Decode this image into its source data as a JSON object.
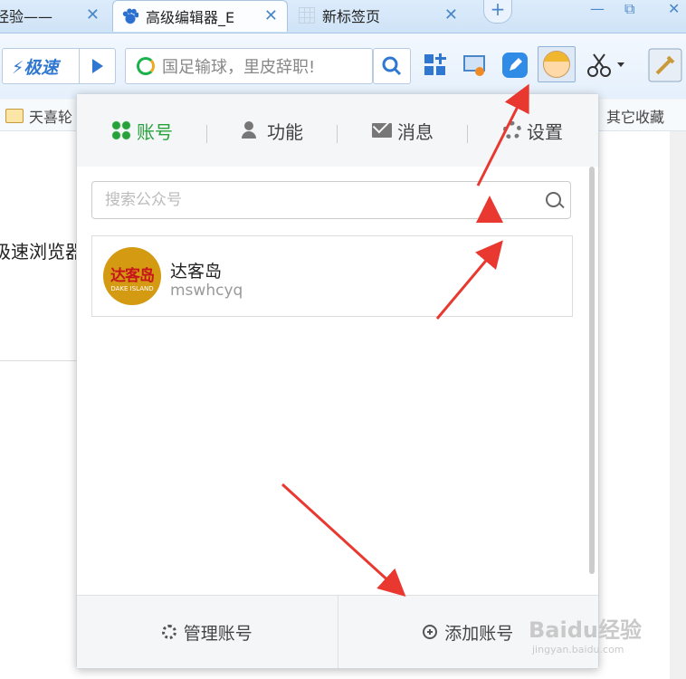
{
  "tabs": [
    {
      "label": "经验——",
      "active": false
    },
    {
      "label": "高级编辑器_E",
      "active": true,
      "icon": "baidu-paw-icon"
    },
    {
      "label": "新标签页",
      "active": false,
      "icon": "grid-icon"
    }
  ],
  "window_controls": {
    "minimize": "—",
    "restore": "⧉",
    "close": "✕"
  },
  "toolbar": {
    "speed_label": "⚡极速",
    "search_text": "国足输球，里皮辞职!",
    "icons": [
      "search-button-icon",
      "apps-plus-icon",
      "screenshot-icon",
      "edit-icon",
      "avatar-icon",
      "scissors-icon",
      "tools-icon"
    ]
  },
  "bookmarks": {
    "left_label": "天喜轮",
    "right_label": "其它收藏"
  },
  "page_behind": {
    "text": "极速浏览器"
  },
  "panel": {
    "tabs": [
      {
        "label": "账号",
        "active": true,
        "icon": "apps-icon"
      },
      {
        "label": "功能",
        "active": false,
        "icon": "user-gear-icon"
      },
      {
        "label": "消息",
        "active": false,
        "icon": "mail-icon"
      },
      {
        "label": "设置",
        "active": false,
        "icon": "gear-icon"
      }
    ],
    "search_placeholder": "搜索公众号",
    "account": {
      "name": "达客岛",
      "id": "mswhcyq",
      "logo_text": "达客岛",
      "logo_sub": "DAKE ISLAND"
    },
    "footer": {
      "manage_label": "管理账号",
      "add_label": "添加账号"
    }
  },
  "watermark": {
    "main": "Baidu经验",
    "sub": "jingyan.baidu.com"
  },
  "colors": {
    "accent_green": "#27a23b",
    "arrow_red": "#e8382f",
    "brand_blue": "#2f77d1"
  }
}
